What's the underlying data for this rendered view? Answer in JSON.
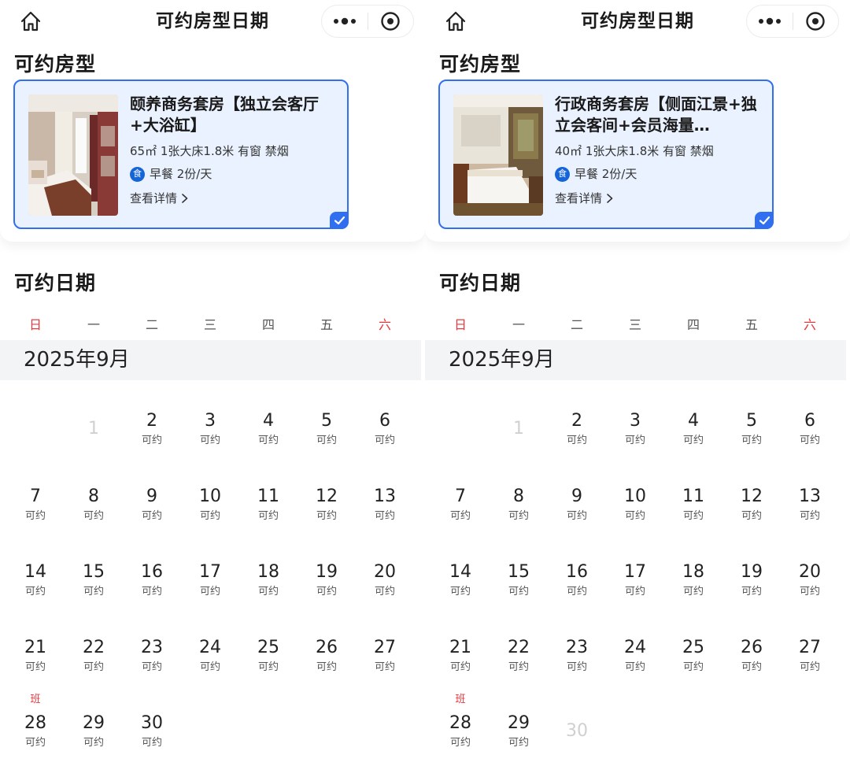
{
  "nav": {
    "title": "可约房型日期"
  },
  "labels": {
    "room_section": "可约房型",
    "date_section": "可约日期",
    "month": "2025年9月",
    "weekdays": [
      "日",
      "一",
      "二",
      "三",
      "四",
      "五",
      "六"
    ],
    "avail": "可约",
    "detail": "查看详情",
    "breakfast_icon": "食",
    "work_tag": "班"
  },
  "colors": {
    "accent": "#2f6ff0",
    "card_bg": "#eaf2ff",
    "weekend": "#e8383d",
    "badge": "#1565d8"
  },
  "icons": [
    "home-icon",
    "more-dots-icon",
    "target-close-icon",
    "chevron-right-icon",
    "check-icon",
    "breakfast-icon"
  ],
  "panels": [
    {
      "room": {
        "name": "颐养商务套房【独立会客厅+大浴缸】",
        "spec": "65㎡ 1张大床1.8米 有窗 禁烟",
        "breakfast": "早餐 2份/天"
      },
      "calendar": {
        "first_weekday": 1,
        "days": [
          {
            "d": "1",
            "avail": false
          },
          {
            "d": "2",
            "avail": true
          },
          {
            "d": "3",
            "avail": true
          },
          {
            "d": "4",
            "avail": true
          },
          {
            "d": "5",
            "avail": true
          },
          {
            "d": "6",
            "avail": true
          },
          {
            "d": "7",
            "avail": true
          },
          {
            "d": "8",
            "avail": true
          },
          {
            "d": "9",
            "avail": true
          },
          {
            "d": "10",
            "avail": true
          },
          {
            "d": "11",
            "avail": true
          },
          {
            "d": "12",
            "avail": true
          },
          {
            "d": "13",
            "avail": true
          },
          {
            "d": "14",
            "avail": true
          },
          {
            "d": "15",
            "avail": true
          },
          {
            "d": "16",
            "avail": true
          },
          {
            "d": "17",
            "avail": true
          },
          {
            "d": "18",
            "avail": true
          },
          {
            "d": "19",
            "avail": true
          },
          {
            "d": "20",
            "avail": true
          },
          {
            "d": "21",
            "avail": true
          },
          {
            "d": "22",
            "avail": true
          },
          {
            "d": "23",
            "avail": true
          },
          {
            "d": "24",
            "avail": true
          },
          {
            "d": "25",
            "avail": true
          },
          {
            "d": "26",
            "avail": true
          },
          {
            "d": "27",
            "avail": true
          },
          {
            "d": "28",
            "avail": true,
            "tag": true
          },
          {
            "d": "29",
            "avail": true
          },
          {
            "d": "30",
            "avail": true
          }
        ]
      }
    },
    {
      "room": {
        "name": "行政商务套房【侧面江景+独立会客间+会员海量…",
        "spec": "40㎡ 1张大床1.8米 有窗 禁烟",
        "breakfast": "早餐 2份/天"
      },
      "calendar": {
        "first_weekday": 1,
        "days": [
          {
            "d": "1",
            "avail": false
          },
          {
            "d": "2",
            "avail": true
          },
          {
            "d": "3",
            "avail": true
          },
          {
            "d": "4",
            "avail": true
          },
          {
            "d": "5",
            "avail": true
          },
          {
            "d": "6",
            "avail": true
          },
          {
            "d": "7",
            "avail": true
          },
          {
            "d": "8",
            "avail": true
          },
          {
            "d": "9",
            "avail": true
          },
          {
            "d": "10",
            "avail": true
          },
          {
            "d": "11",
            "avail": true
          },
          {
            "d": "12",
            "avail": true
          },
          {
            "d": "13",
            "avail": true
          },
          {
            "d": "14",
            "avail": true
          },
          {
            "d": "15",
            "avail": true
          },
          {
            "d": "16",
            "avail": true
          },
          {
            "d": "17",
            "avail": true
          },
          {
            "d": "18",
            "avail": true
          },
          {
            "d": "19",
            "avail": true
          },
          {
            "d": "20",
            "avail": true
          },
          {
            "d": "21",
            "avail": true
          },
          {
            "d": "22",
            "avail": true
          },
          {
            "d": "23",
            "avail": true
          },
          {
            "d": "24",
            "avail": true
          },
          {
            "d": "25",
            "avail": true
          },
          {
            "d": "26",
            "avail": true
          },
          {
            "d": "27",
            "avail": true
          },
          {
            "d": "28",
            "avail": true,
            "tag": true
          },
          {
            "d": "29",
            "avail": true
          },
          {
            "d": "30",
            "avail": false
          }
        ]
      }
    }
  ]
}
